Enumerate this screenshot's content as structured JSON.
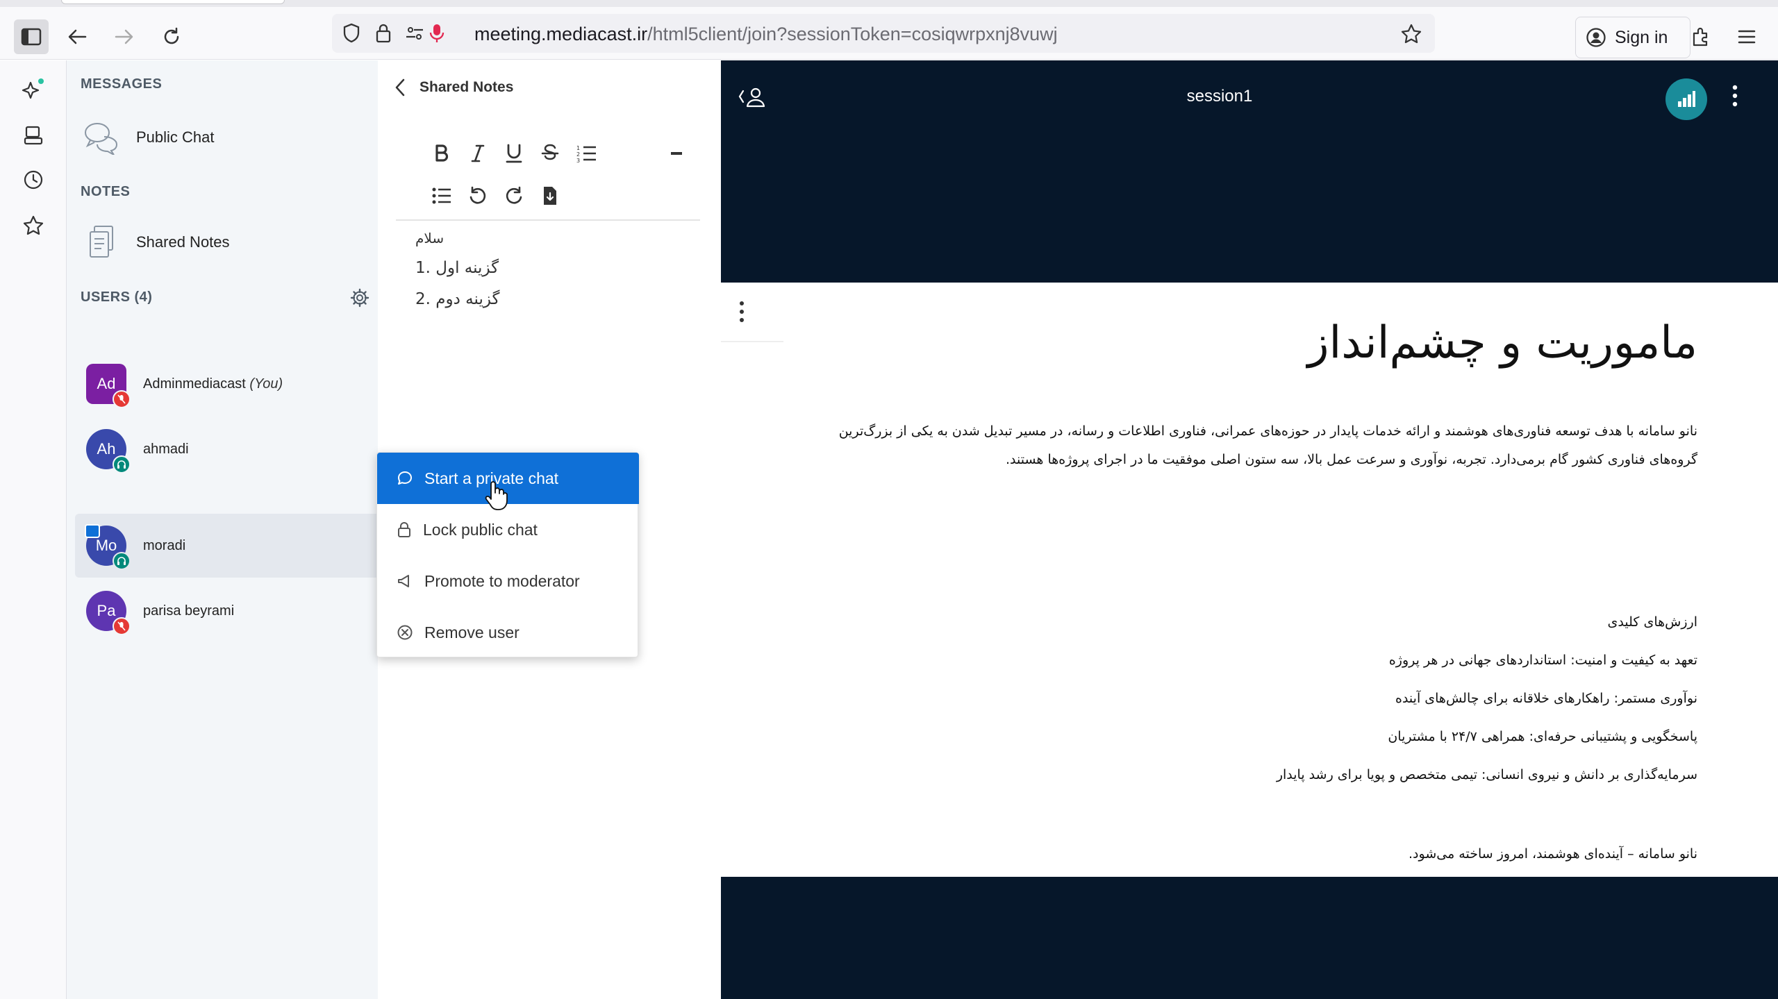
{
  "browser": {
    "url_host": "meeting.mediacast.ir",
    "url_path": "/html5client/join?sessionToken=cosiqwrpxnj8vuwj",
    "sign_in": "Sign in"
  },
  "sidebar": {
    "messages_title": "MESSAGES",
    "public_chat": "Public Chat",
    "notes_title": "NOTES",
    "shared_notes": "Shared Notes",
    "users_title": "USERS (4)",
    "users": [
      {
        "initials": "Ad",
        "name": "Adminmediacast",
        "suffix": "(You)",
        "color": "#7b1fa2",
        "badge": "#e53935"
      },
      {
        "initials": "Ah",
        "name": "ahmadi",
        "suffix": "",
        "color": "#3949ab",
        "badge": "#00897b"
      },
      {
        "initials": "Mo",
        "name": "moradi",
        "suffix": "",
        "color": "#3949ab",
        "badge": "#00897b"
      },
      {
        "initials": "Pa",
        "name": "parisa beyrami",
        "suffix": "",
        "color": "#5e35b1",
        "badge": "#e53935"
      }
    ]
  },
  "notes": {
    "header": "Shared Notes",
    "lines": [
      "سلام",
      "1. گزینه اول",
      "2. گزینه دوم"
    ]
  },
  "context_menu": {
    "items": [
      "Start a private chat",
      "Lock public chat",
      "Promote to moderator",
      "Remove user"
    ]
  },
  "stage": {
    "title": "session1",
    "slide": {
      "heading": "ماموریت و چشم‌انداز",
      "paragraph": "نانو سامانه با هدف توسعه فناوری‌های هوشمند و ارائه خدمات پایدار در حوزه‌های عمرانی، فناوری اطلاعات و رسانه، در مسیر تبدیل شدن به یکی از بزرگ‌ترین گروه‌های فناوری کشور گام برمی‌دارد. تجربه، نوآوری و سرعت عمل بالا، سه ستون اصلی موفقیت ما در اجرای پروژه‌ها هستند.",
      "values_title": "ارزش‌های کلیدی",
      "values": [
        "تعهد به کیفیت و امنیت: استانداردهای جهانی در هر پروژه",
        "نوآوری مستمر: راهکارهای خلاقانه برای چالش‌های آینده",
        "پاسخگویی و پشتیبانی حرفه‌ای: همراهی ۲۴/۷ با مشتریان",
        "سرمایه‌گذاری بر دانش و نیروی انسانی: تیمی متخصص و پویا برای رشد پایدار"
      ],
      "tagline": "نانو سامانه – آینده‌ای هوشمند، امروز ساخته می‌شود."
    }
  },
  "colors": {
    "accent": "#0f70d7",
    "stage_bg": "#06172a",
    "nav_bg": "#f3f6f9"
  }
}
